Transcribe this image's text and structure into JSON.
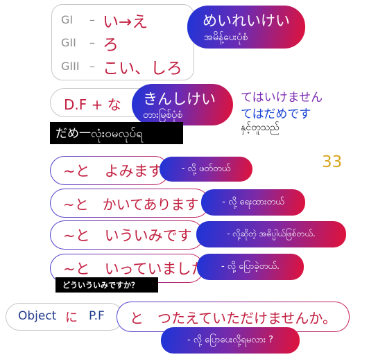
{
  "grades": {
    "g1": {
      "label": "GI",
      "dash": "–",
      "value": "い→え"
    },
    "g2": {
      "label": "GII",
      "dash": "–",
      "value": "ろ"
    },
    "g3": {
      "label": "GIII",
      "dash": "–",
      "value": "こい、しろ"
    }
  },
  "meireikei": {
    "jp": "めいれいけい",
    "mm": "အမိန့်ပေးပုံစံ"
  },
  "df_na": {
    "text": "D.F + な"
  },
  "kinshikei": {
    "jp": "きんしけい",
    "mm": "တားမြစ်ပုံစံ"
  },
  "te_phrases": {
    "line1": "てはいけません",
    "line2": "てはだめです",
    "line3": "နှင့်တူသည်"
  },
  "dame": {
    "text": "だめ一လုံးဝမလုပ်ရ"
  },
  "page_number": "33",
  "rows": [
    {
      "jp": "~と　よみます",
      "mm": "- လို့ ဖတ်တယ်"
    },
    {
      "jp": "~と　かいてあります",
      "mm": "- လို့ ရေးထားတယ်"
    },
    {
      "jp": "~と　いういみです",
      "mm": "- လို့ဆိုတဲ့ အဓိပ္ပါယ်ဖြစ်တယ်."
    },
    {
      "jp": "~と　いっていました",
      "mm": "- လို့ ပြောခဲ့တယ်."
    }
  ],
  "douiu": {
    "text": "どういういみですか？"
  },
  "object_pf": {
    "object": "Object",
    "ni": "に",
    "pf": "P.F"
  },
  "request": {
    "jp": "と　つたえていただけませんか。",
    "mm": "- လို့ ပြောပေးလို့ရမလား ?"
  }
}
